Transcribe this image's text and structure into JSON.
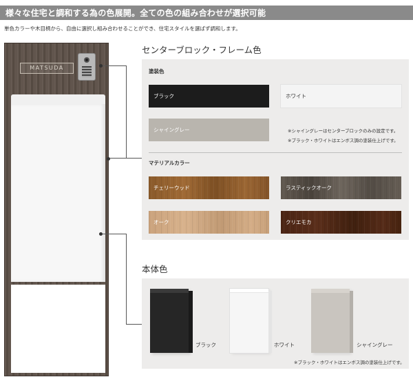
{
  "header": {
    "banner": "様々な住宅と調和する為の色展開。全ての色の組み合わせが選択可能",
    "intro": "単色カラーや木目柄から、自由に選択し組み合わせることができ、住宅スタイルを選ばず調和します。"
  },
  "product": {
    "nameplate": "MATSUDA"
  },
  "frame": {
    "title": "センターブロック・フレーム色",
    "painted_label": "塗装色",
    "painted": [
      {
        "label": "ブラック",
        "color": "#1c1c1c",
        "text_color": "#ffffff"
      },
      {
        "label": "ホワイト",
        "color": "#f4f4f4",
        "text_color": "#333333"
      },
      {
        "label": "シャイングレー",
        "color": "#b9b5ae",
        "text_color": "#ffffff"
      }
    ],
    "notes": [
      "※シャイングレーはセンターブロックのみの設定です。",
      "※ブラック・ホワイトはエンボス調の塗装仕上げです。"
    ],
    "material_label": "マテリアルカラー",
    "materials": [
      {
        "label": "チェリーウッド",
        "text_color": "#ffffff"
      },
      {
        "label": "ラスティックオーク",
        "text_color": "#ffffff"
      },
      {
        "label": "オーク",
        "text_color": "#ffffff"
      },
      {
        "label": "クリエモカ",
        "text_color": "#ffffff"
      }
    ]
  },
  "body": {
    "title": "本体色",
    "items": [
      {
        "label": "ブラック",
        "color": "#262626"
      },
      {
        "label": "ホワイト",
        "color": "#f6f6f6"
      },
      {
        "label": "シャイングレー",
        "color": "#c9c5bf"
      }
    ],
    "note": "※ブラック・ホワイトはエンボス調の塗装仕上げです。"
  }
}
